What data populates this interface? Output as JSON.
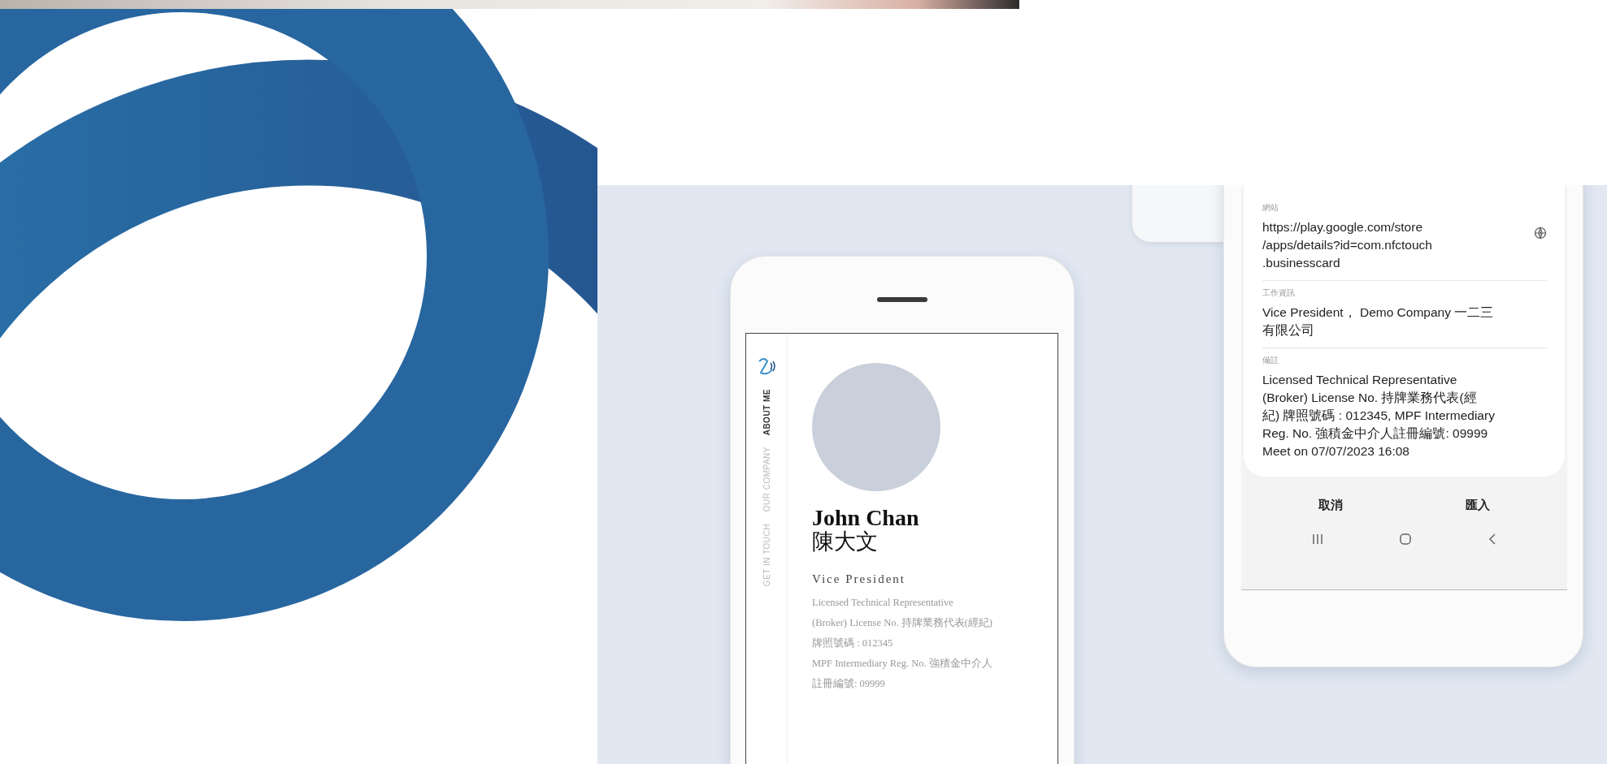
{
  "card_app": {
    "nav": [
      {
        "label": "ABOUT ME",
        "selected": true
      },
      {
        "label": "OUR COMPANY",
        "selected": false
      },
      {
        "label": "GET IN TOUCH",
        "selected": false
      }
    ],
    "name": "John Chan",
    "name_zh": "陳大文",
    "title": "Vice President",
    "description_lines": [
      "Licensed Technical Representative",
      "(Broker) License No. 持牌業務代表(經紀)",
      "牌照號碼 : 012345",
      "MPF Intermediary Reg. No. 強積金中介人",
      "註冊編號: 09999"
    ]
  },
  "import_dialog": {
    "fields": [
      {
        "kind": "link",
        "label": "網站",
        "lines": [
          "https://play.google.com/store",
          "/apps/details?id=com.nfctouch",
          ".businesscard"
        ]
      },
      {
        "kind": "text",
        "label": "工作資訊",
        "lines": [
          "Vice President， Demo Company 一二三",
          "有限公司"
        ]
      },
      {
        "kind": "text",
        "label": "備註",
        "lines": [
          "Licensed Technical Representative",
          "(Broker) License No. 持牌業務代表(經",
          "紀) 牌照號碼 : 012345, MPF Intermediary",
          "Reg. No. 強積金中介人註冊編號: 09999",
          "Meet on 07/07/2023 16:08"
        ]
      }
    ],
    "buttons": [
      "取消",
      "匯入"
    ]
  }
}
